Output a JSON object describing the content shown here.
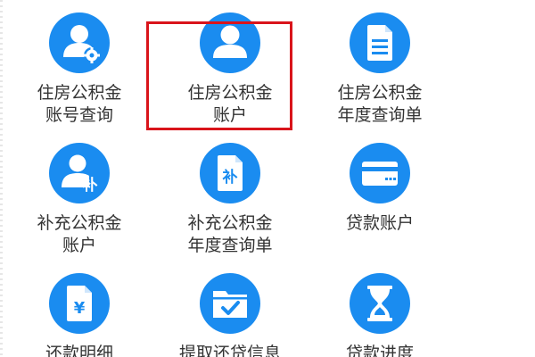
{
  "tiles": [
    {
      "line1": "住房公积金",
      "line2": "账号查询",
      "icon": "user-gear-icon"
    },
    {
      "line1": "住房公积金",
      "line2": "账户",
      "icon": "user-icon"
    },
    {
      "line1": "住房公积金",
      "line2": "年度查询单",
      "icon": "document-icon"
    },
    {
      "line1": "补充公积金",
      "line2": "账户",
      "icon": "user-supplement-icon"
    },
    {
      "line1": "补充公积金",
      "line2": "年度查询单",
      "icon": "supplement-document-icon"
    },
    {
      "line1": "贷款账户",
      "line2": "",
      "icon": "card-icon"
    },
    {
      "line1": "还款明细",
      "line2": "",
      "icon": "yen-document-icon"
    },
    {
      "line1": "提取还贷信息",
      "line2": "",
      "icon": "folder-check-icon"
    },
    {
      "line1": "贷款进度",
      "line2": "",
      "icon": "hourglass-icon"
    }
  ],
  "icon_glyphs": {
    "supplement": "补",
    "yen": "¥"
  },
  "colors": {
    "icon_blue": "#1a8cf0",
    "label_text": "#333333",
    "highlight_border": "#d9141b"
  }
}
